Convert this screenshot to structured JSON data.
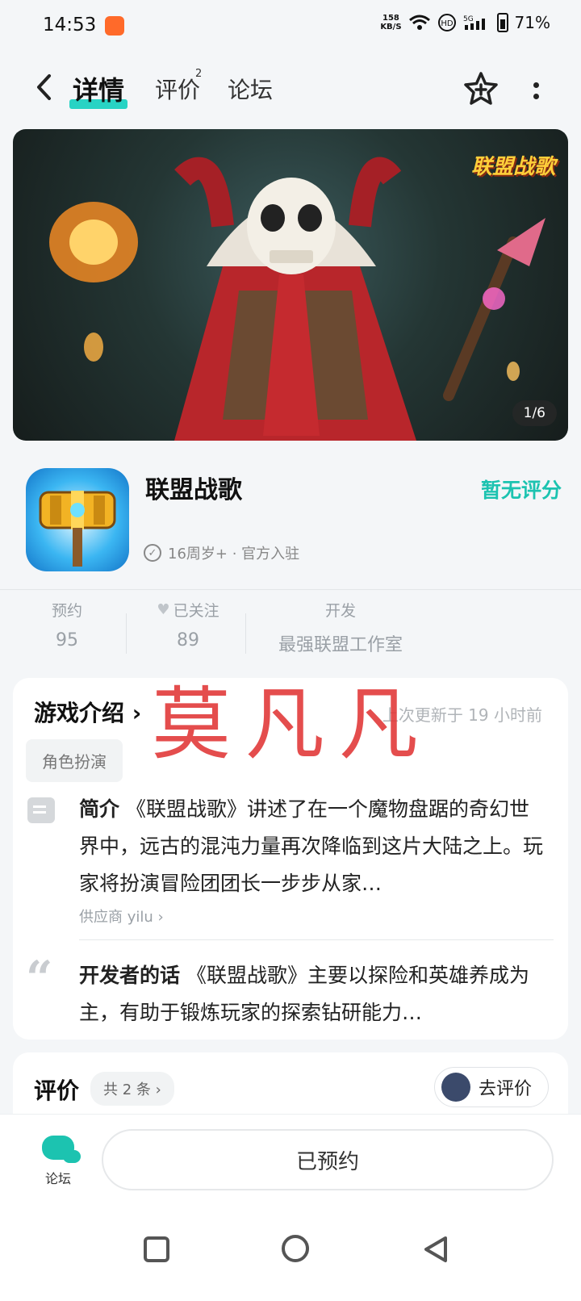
{
  "status_bar": {
    "time": "14:53",
    "net_speed_value": "158",
    "net_speed_unit": "KB/S",
    "battery": "71%"
  },
  "nav": {
    "tabs": [
      {
        "label": "详情",
        "active": true
      },
      {
        "label": "评价",
        "badge": "2"
      },
      {
        "label": "论坛"
      }
    ]
  },
  "banner": {
    "counter": "1/6",
    "logo_text": "联盟战歌"
  },
  "app": {
    "name": "联盟战歌",
    "meta": "16周岁+ · 官方入驻",
    "rating": "暂无评分"
  },
  "stats": [
    {
      "label": "预约",
      "value": "95"
    },
    {
      "label": "已关注",
      "value": "89"
    },
    {
      "label": "开发",
      "value": "最强联盟工作室"
    }
  ],
  "intro": {
    "title": "游戏介绍",
    "updated": "上次更新于 19 小时前",
    "tag": "角色扮演",
    "summary_label": "简介",
    "summary": "《联盟战歌》讲述了在一个魔物盘踞的奇幻世界中，远古的混沌力量再次降临到这片大陆之上。玩家将扮演冒险团团长一步步从家…",
    "supplier": "供应商 yilu",
    "dev_label": "开发者的话",
    "dev_words": "《联盟战歌》主要以探险和英雄养成为主，有助于锻炼玩家的探索钻研能力…"
  },
  "watermark": "莫凡凡",
  "reviews": {
    "title": "评价",
    "count": "共 2 条",
    "go_review": "去评价"
  },
  "bottom": {
    "forum_label": "论坛",
    "reserve_label": "已预约"
  },
  "colors": {
    "accent": "#1cc3b0",
    "watermark": "#e23a3a"
  }
}
